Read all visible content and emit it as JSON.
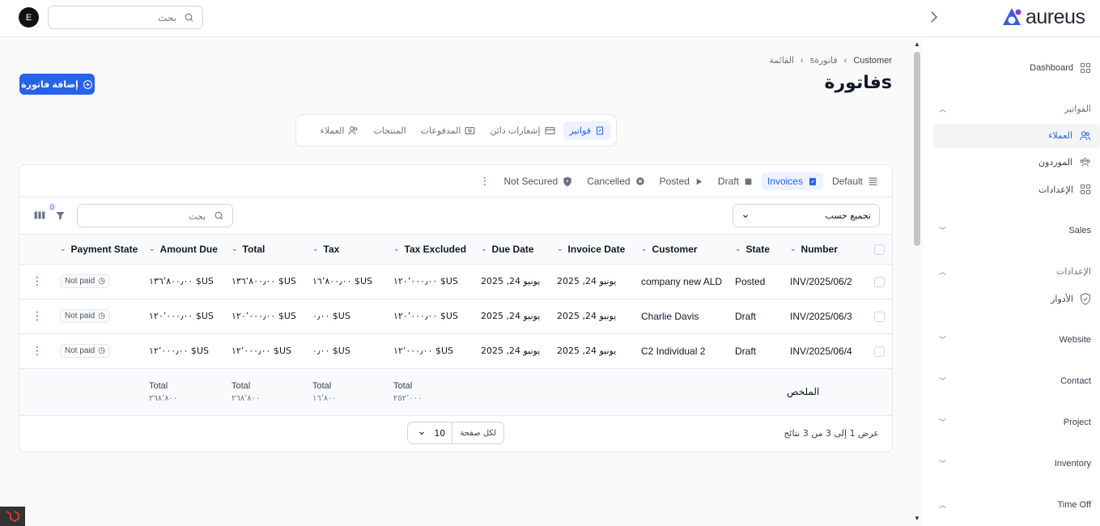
{
  "header": {
    "avatar_initial": "E",
    "search_placeholder": "بحث",
    "logo_text": "aureus"
  },
  "breadcrumb": [
    "Customer",
    "فاتورةs",
    "القائمة"
  ],
  "page_title": "فاتورةs",
  "add_button": "إضافة فاتورة",
  "resource_tabs": [
    {
      "label": "فواتير",
      "icon": "invoice-icon",
      "active": true
    },
    {
      "label": "إشعارات دائن",
      "icon": "credit-card-icon",
      "active": false
    },
    {
      "label": "المدفوعات",
      "icon": "payment-icon",
      "active": false
    },
    {
      "label": "المنتجات",
      "icon": "",
      "active": false
    },
    {
      "label": "العملاء",
      "icon": "users-icon",
      "active": false
    }
  ],
  "view_tabs": [
    {
      "label": "Default",
      "icon": "list-icon",
      "active": false
    },
    {
      "label": "Invoices",
      "icon": "invoice-icon",
      "active": true
    },
    {
      "label": "Draft",
      "icon": "square-icon",
      "active": false
    },
    {
      "label": "Posted",
      "icon": "play-icon",
      "active": false
    },
    {
      "label": "Cancelled",
      "icon": "x-circle-icon",
      "active": false
    },
    {
      "label": "Not Secured",
      "icon": "shield-icon",
      "active": false
    }
  ],
  "toolbar": {
    "group_by": "تجميع حسب",
    "search_placeholder": "بحث",
    "filter_count": "0"
  },
  "columns": [
    "Number",
    "State",
    "Customer",
    "Invoice Date",
    "Due Date",
    "Tax Excluded",
    "Tax",
    "Total",
    "Amount Due",
    "Payment State"
  ],
  "rows": [
    {
      "number": "INV/2025/06/2",
      "state": "Posted",
      "customer": "company new ALD",
      "invoice_date": "يونيو 24, 2025",
      "due_date": "يونيو 24, 2025",
      "tax_excluded": "US$ ١٢٠٬٠٠٠٫٠٠",
      "tax": "US$ ١٦٬٨٠٠٫٠٠",
      "total": "US$ ١٣٦٬٨٠٠٫٠٠",
      "amount_due": "US$ ١٣٦٬٨٠٠٫٠٠",
      "payment_state": "Not paid"
    },
    {
      "number": "INV/2025/06/3",
      "state": "Draft",
      "customer": "Charlie Davis",
      "invoice_date": "يونيو 24, 2025",
      "due_date": "يونيو 24, 2025",
      "tax_excluded": "US$ ١٢٠٬٠٠٠٫٠٠",
      "tax": "US$ ٠٫٠٠",
      "total": "US$ ١٢٠٬٠٠٠٫٠٠",
      "amount_due": "US$ ١٢٠٬٠٠٠٫٠٠",
      "payment_state": "Not paid"
    },
    {
      "number": "INV/2025/06/4",
      "state": "Draft",
      "customer": "C2 Individual 2",
      "invoice_date": "يونيو 24, 2025",
      "due_date": "يونيو 24, 2025",
      "tax_excluded": "US$ ١٢٬٠٠٠٫٠٠",
      "tax": "US$ ٠٫٠٠",
      "total": "US$ ١٢٬٠٠٠٫٠٠",
      "amount_due": "US$ ١٢٬٠٠٠٫٠٠",
      "payment_state": "Not paid"
    }
  ],
  "summary": {
    "label": "الملخص",
    "total_label": "Total",
    "tax_excluded": "٢٥٢٬٠٠٠",
    "tax": "١٦٬٨٠٠",
    "total": "٢٦٨٬٨٠٠",
    "amount_due": "٢٦٨٬٨٠٠"
  },
  "footer": {
    "results": "عرض 1 إلى 3 من 3 نتائج",
    "per_page_label": "لكل صفحة",
    "per_page_value": "10"
  },
  "sidebar": {
    "dashboard": "Dashboard",
    "sections": [
      {
        "label": "الفواتير",
        "expanded": true
      },
      {
        "label": "Sales",
        "expanded": false
      },
      {
        "label": "الإعدادات",
        "expanded": true
      },
      {
        "label": "Website",
        "expanded": false
      },
      {
        "label": "Contact",
        "expanded": false
      },
      {
        "label": "Project",
        "expanded": false
      },
      {
        "label": "Inventory",
        "expanded": false
      },
      {
        "label": "Time Off",
        "expanded": true
      }
    ],
    "invoice_items": [
      "العملاء",
      "الموردون",
      "الإعدادات"
    ],
    "settings_items": [
      "الأدوار"
    ]
  },
  "colors": {
    "accent": "#2563eb",
    "border": "#e5e7eb",
    "background": "#fafafa"
  }
}
